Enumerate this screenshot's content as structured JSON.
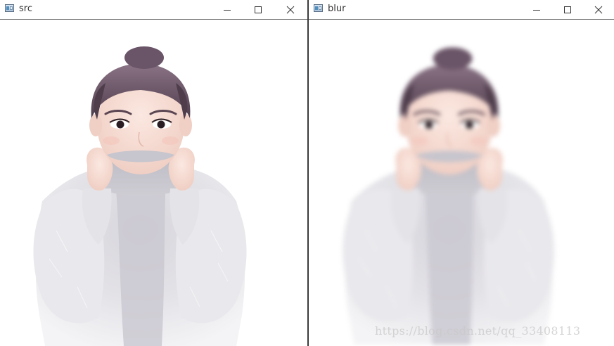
{
  "windows": [
    {
      "title": "src",
      "controls": {
        "minimize": "minimize",
        "maximize": "maximize",
        "close": "close"
      }
    },
    {
      "title": "blur",
      "controls": {
        "minimize": "minimize",
        "maximize": "maximize",
        "close": "close"
      }
    }
  ],
  "watermark": "https://blog.csdn.net/qq_33408113",
  "icons": [
    "opencv-window-icon",
    "minimize-icon",
    "maximize-icon",
    "close-icon"
  ],
  "colors": {
    "titlebar_bg": "#ffffff",
    "title_text": "#333333",
    "divider": "#3b3b3b",
    "sweater": "#e6e6ea",
    "hair": "#5d4a5a",
    "skin": "#f7dcd3"
  }
}
